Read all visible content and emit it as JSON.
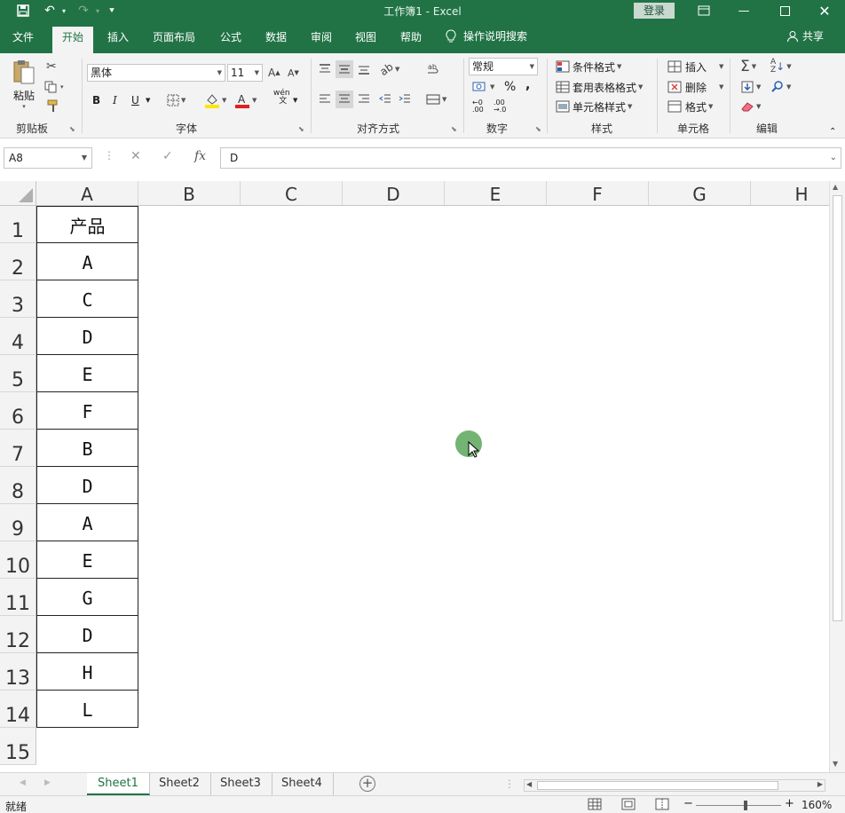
{
  "window": {
    "title": "工作簿1  -  Excel",
    "login_label": "登录"
  },
  "menu": {
    "tabs": [
      "文件",
      "开始",
      "插入",
      "页面布局",
      "公式",
      "数据",
      "审阅",
      "视图",
      "帮助"
    ],
    "active_tab": "开始",
    "tell_me": "操作说明搜索",
    "share": "共享"
  },
  "ribbon": {
    "clipboard": {
      "label": "剪贴板",
      "paste": "粘贴"
    },
    "font": {
      "label": "字体",
      "name": "黑体",
      "size": "11",
      "bold": "B",
      "italic": "I",
      "underline": "U",
      "wen": "wén\n文"
    },
    "alignment": {
      "label": "对齐方式"
    },
    "number": {
      "label": "数字",
      "format": "常规",
      "percent": "%",
      "comma": ","
    },
    "styles": {
      "label": "样式",
      "conditional": "条件格式",
      "table": "套用表格格式",
      "cell_styles": "单元格样式"
    },
    "cells": {
      "label": "单元格",
      "insert": "插入",
      "delete": "删除",
      "format": "格式"
    },
    "editing": {
      "label": "编辑"
    }
  },
  "formula_bar": {
    "name_box": "A8",
    "formula": "D",
    "fx": "fx"
  },
  "sheet": {
    "columns": [
      "A",
      "B",
      "C",
      "D",
      "E",
      "F",
      "G",
      "H"
    ],
    "rows": [
      "1",
      "2",
      "3",
      "4",
      "5",
      "6",
      "7",
      "8",
      "9",
      "10",
      "11",
      "12",
      "13",
      "14",
      "15"
    ],
    "cells_A": [
      "产品",
      "A",
      "C",
      "D",
      "E",
      "F",
      "B",
      "D",
      "A",
      "E",
      "G",
      "D",
      "H",
      "L"
    ]
  },
  "sheet_tabs": [
    "Sheet1",
    "Sheet2",
    "Sheet3",
    "Sheet4"
  ],
  "active_sheet": "Sheet1",
  "status": {
    "ready": "就绪",
    "zoom": "160%"
  },
  "colors": {
    "brand": "#217346",
    "ribbon_bg": "#f3f3f3"
  }
}
